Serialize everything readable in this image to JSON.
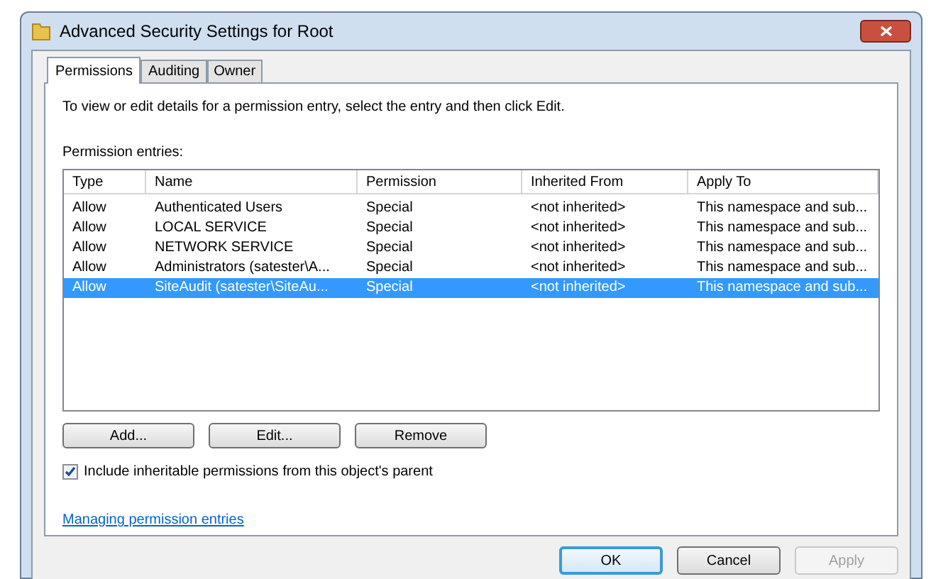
{
  "window": {
    "title": "Advanced Security Settings for Root"
  },
  "tabs": [
    {
      "label": "Permissions",
      "selected": true
    },
    {
      "label": "Auditing",
      "selected": false
    },
    {
      "label": "Owner",
      "selected": false
    }
  ],
  "instructions": "To view or edit details for a permission entry, select the entry and then click Edit.",
  "entries_label": "Permission entries:",
  "table": {
    "columns": [
      "Type",
      "Name",
      "Permission",
      "Inherited From",
      "Apply To"
    ],
    "rows": [
      {
        "cells": [
          "Allow",
          "Authenticated Users",
          "Special",
          "<not inherited>",
          "This namespace and sub..."
        ],
        "selected": false
      },
      {
        "cells": [
          "Allow",
          "LOCAL SERVICE",
          "Special",
          "<not inherited>",
          "This namespace and sub..."
        ],
        "selected": false
      },
      {
        "cells": [
          "Allow",
          "NETWORK SERVICE",
          "Special",
          "<not inherited>",
          "This namespace and sub..."
        ],
        "selected": false
      },
      {
        "cells": [
          "Allow",
          "Administrators (satester\\A...",
          "Special",
          "<not inherited>",
          "This namespace and sub..."
        ],
        "selected": false
      },
      {
        "cells": [
          "Allow",
          "SiteAudit (satester\\SiteAu...",
          "Special",
          "<not inherited>",
          "This namespace and sub..."
        ],
        "selected": true
      }
    ]
  },
  "entry_buttons": [
    "Add...",
    "Edit...",
    "Remove"
  ],
  "inherit_checkbox": {
    "label": "Include inheritable permissions from this object's parent",
    "checked": true
  },
  "help_link": "Managing permission entries",
  "dialog_buttons": [
    {
      "label": "OK",
      "kind": "default",
      "disabled": false
    },
    {
      "label": "Cancel",
      "kind": "normal",
      "disabled": false
    },
    {
      "label": "Apply",
      "kind": "normal",
      "disabled": true
    }
  ]
}
